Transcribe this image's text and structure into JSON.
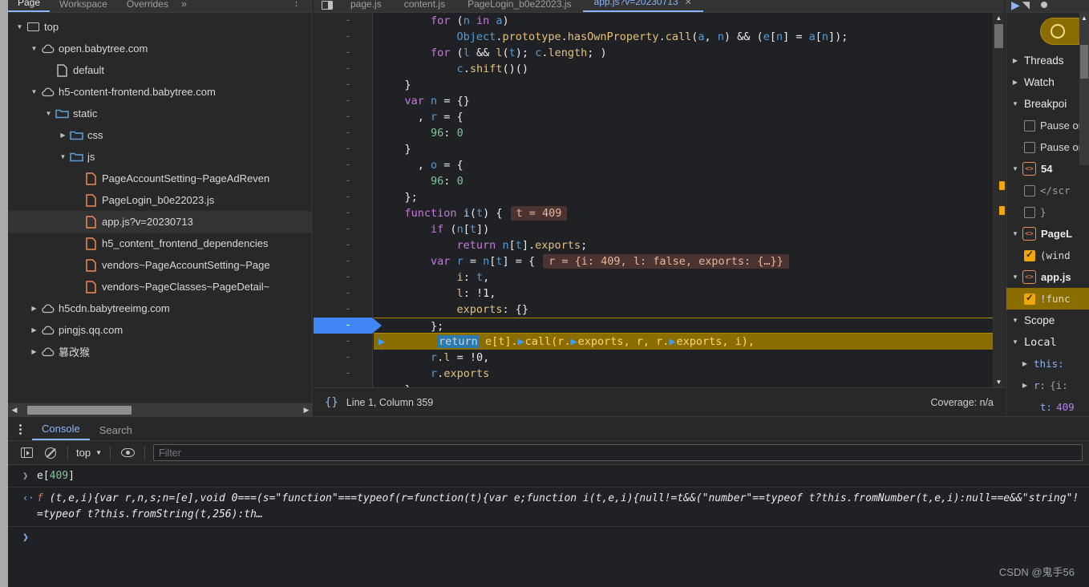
{
  "navigator": {
    "tabs": [
      {
        "label": "Page",
        "active": true
      },
      {
        "label": "Workspace",
        "active": false
      },
      {
        "label": "Overrides",
        "active": false
      }
    ],
    "more_label": "»",
    "kebab_label": "⋮",
    "tree": [
      {
        "indent": 0,
        "twisty": "▼",
        "icon": "frame-icon",
        "label": "top",
        "selected": false
      },
      {
        "indent": 1,
        "twisty": "▼",
        "icon": "cloud-icon",
        "label": "open.babytree.com",
        "selected": false
      },
      {
        "indent": 2,
        "twisty": "",
        "icon": "file-icon-plain",
        "label": "default",
        "selected": false
      },
      {
        "indent": 1,
        "twisty": "▼",
        "icon": "cloud-icon",
        "label": "h5-content-frontend.babytree.com",
        "selected": false
      },
      {
        "indent": 2,
        "twisty": "▼",
        "icon": "folder-icon",
        "label": "static",
        "selected": false
      },
      {
        "indent": 3,
        "twisty": "▶",
        "icon": "folder-icon",
        "label": "css",
        "selected": false
      },
      {
        "indent": 3,
        "twisty": "▼",
        "icon": "folder-icon",
        "label": "js",
        "selected": false
      },
      {
        "indent": 4,
        "twisty": "",
        "icon": "js-file-icon",
        "label": "PageAccountSetting~PageAdReven",
        "selected": false
      },
      {
        "indent": 4,
        "twisty": "",
        "icon": "js-file-icon",
        "label": "PageLogin_b0e22023.js",
        "selected": false
      },
      {
        "indent": 4,
        "twisty": "",
        "icon": "js-file-icon",
        "label": "app.js?v=20230713",
        "selected": true
      },
      {
        "indent": 4,
        "twisty": "",
        "icon": "js-file-icon",
        "label": "h5_content_frontend_dependencies",
        "selected": false
      },
      {
        "indent": 4,
        "twisty": "",
        "icon": "js-file-icon",
        "label": "vendors~PageAccountSetting~Page",
        "selected": false
      },
      {
        "indent": 4,
        "twisty": "",
        "icon": "js-file-icon",
        "label": "vendors~PageClasses~PageDetail~",
        "selected": false
      },
      {
        "indent": 1,
        "twisty": "▶",
        "icon": "cloud-icon",
        "label": "h5cdn.babytreeimg.com",
        "selected": false
      },
      {
        "indent": 1,
        "twisty": "▶",
        "icon": "cloud-icon",
        "label": "pingjs.qq.com",
        "selected": false
      },
      {
        "indent": 1,
        "twisty": "▶",
        "icon": "cloud-icon",
        "label": "篡改猴",
        "selected": false
      }
    ]
  },
  "editor": {
    "tabs": [
      {
        "label": "page.js",
        "active": false
      },
      {
        "label": "content.js",
        "active": false
      },
      {
        "label": "PageLogin_b0e22023.js",
        "active": false
      },
      {
        "label": "app.js?v=20230713",
        "active": true,
        "close": "✕"
      }
    ],
    "gutter_marks": [
      "-",
      "-",
      "-",
      "-",
      "-",
      "-",
      "-",
      "-",
      "-",
      "-",
      "-",
      "-",
      "-",
      "-",
      "-",
      "-",
      "-",
      "-",
      "-",
      "-",
      "-",
      "-",
      "-"
    ],
    "paused_line_index": 19,
    "lines": [
      {
        "segments": [
          {
            "t": "        ",
            "c": "plain"
          },
          {
            "t": "for",
            "c": "kw"
          },
          {
            "t": " (",
            "c": "punc"
          },
          {
            "t": "n",
            "c": "var"
          },
          {
            "t": " ",
            "c": "punc"
          },
          {
            "t": "in",
            "c": "kw"
          },
          {
            "t": " ",
            "c": "punc"
          },
          {
            "t": "a",
            "c": "var"
          },
          {
            "t": ")",
            "c": "punc"
          }
        ]
      },
      {
        "segments": [
          {
            "t": "            ",
            "c": "plain"
          },
          {
            "t": "Object",
            "c": "var"
          },
          {
            "t": ".",
            "c": "punc"
          },
          {
            "t": "prototype",
            "c": "prop"
          },
          {
            "t": ".",
            "c": "punc"
          },
          {
            "t": "hasOwnProperty",
            "c": "prop"
          },
          {
            "t": ".",
            "c": "punc"
          },
          {
            "t": "call",
            "c": "prop"
          },
          {
            "t": "(",
            "c": "punc"
          },
          {
            "t": "a",
            "c": "var"
          },
          {
            "t": ", ",
            "c": "punc"
          },
          {
            "t": "n",
            "c": "var"
          },
          {
            "t": ") && (",
            "c": "punc"
          },
          {
            "t": "e",
            "c": "var"
          },
          {
            "t": "[",
            "c": "punc"
          },
          {
            "t": "n",
            "c": "var"
          },
          {
            "t": "] = ",
            "c": "punc"
          },
          {
            "t": "a",
            "c": "var"
          },
          {
            "t": "[",
            "c": "punc"
          },
          {
            "t": "n",
            "c": "var"
          },
          {
            "t": "]);",
            "c": "punc"
          }
        ]
      },
      {
        "segments": [
          {
            "t": "        ",
            "c": "plain"
          },
          {
            "t": "for",
            "c": "kw"
          },
          {
            "t": " (",
            "c": "punc"
          },
          {
            "t": "l",
            "c": "var"
          },
          {
            "t": " ",
            "c": "punc"
          },
          {
            "t": "&&",
            "c": "white"
          },
          {
            "t": " ",
            "c": "punc"
          },
          {
            "t": "l",
            "c": "prop"
          },
          {
            "t": "(",
            "c": "punc"
          },
          {
            "t": "t",
            "c": "var"
          },
          {
            "t": "); ",
            "c": "punc"
          },
          {
            "t": "c",
            "c": "var"
          },
          {
            "t": ".",
            "c": "punc"
          },
          {
            "t": "length",
            "c": "prop"
          },
          {
            "t": "; )",
            "c": "punc"
          }
        ]
      },
      {
        "segments": [
          {
            "t": "            ",
            "c": "plain"
          },
          {
            "t": "c",
            "c": "var"
          },
          {
            "t": ".",
            "c": "punc"
          },
          {
            "t": "shift",
            "c": "prop"
          },
          {
            "t": "()()",
            "c": "punc"
          }
        ]
      },
      {
        "segments": [
          {
            "t": "    }",
            "c": "punc"
          }
        ]
      },
      {
        "segments": [
          {
            "t": "    ",
            "c": "plain"
          },
          {
            "t": "var",
            "c": "kw"
          },
          {
            "t": " ",
            "c": "punc"
          },
          {
            "t": "n",
            "c": "var"
          },
          {
            "t": " = {}",
            "c": "punc"
          }
        ]
      },
      {
        "segments": [
          {
            "t": "      , ",
            "c": "punc"
          },
          {
            "t": "r",
            "c": "var"
          },
          {
            "t": " = {",
            "c": "punc"
          }
        ]
      },
      {
        "segments": [
          {
            "t": "        ",
            "c": "plain"
          },
          {
            "t": "96",
            "c": "num"
          },
          {
            "t": ": ",
            "c": "punc"
          },
          {
            "t": "0",
            "c": "num"
          }
        ]
      },
      {
        "segments": [
          {
            "t": "    }",
            "c": "punc"
          }
        ]
      },
      {
        "segments": [
          {
            "t": "      , ",
            "c": "punc"
          },
          {
            "t": "o",
            "c": "var"
          },
          {
            "t": " = {",
            "c": "punc"
          }
        ]
      },
      {
        "segments": [
          {
            "t": "        ",
            "c": "plain"
          },
          {
            "t": "96",
            "c": "num"
          },
          {
            "t": ": ",
            "c": "punc"
          },
          {
            "t": "0",
            "c": "num"
          }
        ]
      },
      {
        "segments": [
          {
            "t": "    };",
            "c": "punc"
          }
        ]
      },
      {
        "segments": [
          {
            "t": "    ",
            "c": "plain"
          },
          {
            "t": "function",
            "c": "kw"
          },
          {
            "t": " ",
            "c": "punc"
          },
          {
            "t": "i",
            "c": "id"
          },
          {
            "t": "(",
            "c": "punc"
          },
          {
            "t": "t",
            "c": "var"
          },
          {
            "t": ") {",
            "c": "punc"
          }
        ],
        "inline_value": "t = 409"
      },
      {
        "segments": [
          {
            "t": "        ",
            "c": "plain"
          },
          {
            "t": "if",
            "c": "kw"
          },
          {
            "t": " (",
            "c": "punc"
          },
          {
            "t": "n",
            "c": "var"
          },
          {
            "t": "[",
            "c": "punc"
          },
          {
            "t": "t",
            "c": "var"
          },
          {
            "t": "])",
            "c": "punc"
          }
        ]
      },
      {
        "segments": [
          {
            "t": "            ",
            "c": "plain"
          },
          {
            "t": "return",
            "c": "kw"
          },
          {
            "t": " ",
            "c": "punc"
          },
          {
            "t": "n",
            "c": "var"
          },
          {
            "t": "[",
            "c": "punc"
          },
          {
            "t": "t",
            "c": "var"
          },
          {
            "t": "].",
            "c": "punc"
          },
          {
            "t": "exports",
            "c": "prop"
          },
          {
            "t": ";",
            "c": "punc"
          }
        ]
      },
      {
        "segments": [
          {
            "t": "        ",
            "c": "plain"
          },
          {
            "t": "var",
            "c": "kw"
          },
          {
            "t": " ",
            "c": "punc"
          },
          {
            "t": "r",
            "c": "var"
          },
          {
            "t": " = ",
            "c": "punc"
          },
          {
            "t": "n",
            "c": "var"
          },
          {
            "t": "[",
            "c": "punc"
          },
          {
            "t": "t",
            "c": "var"
          },
          {
            "t": "] = {",
            "c": "punc"
          }
        ],
        "inline_value": "r = {i: 409, l: false, exports: {…}}"
      },
      {
        "segments": [
          {
            "t": "            ",
            "c": "plain"
          },
          {
            "t": "i",
            "c": "prop"
          },
          {
            "t": ": ",
            "c": "punc"
          },
          {
            "t": "t",
            "c": "var"
          },
          {
            "t": ",",
            "c": "punc"
          }
        ]
      },
      {
        "segments": [
          {
            "t": "            ",
            "c": "plain"
          },
          {
            "t": "l",
            "c": "prop"
          },
          {
            "t": ": ",
            "c": "punc"
          },
          {
            "t": "!1",
            "c": "white"
          },
          {
            "t": ",",
            "c": "punc"
          }
        ]
      },
      {
        "segments": [
          {
            "t": "            ",
            "c": "plain"
          },
          {
            "t": "exports",
            "c": "prop"
          },
          {
            "t": ": {}",
            "c": "punc"
          }
        ]
      },
      {
        "segments": [
          {
            "t": "        };",
            "c": "punc"
          }
        ]
      },
      {
        "segments": [
          {
            "t": "        ",
            "c": "plain"
          },
          {
            "t": "return",
            "c": "sel"
          },
          {
            "t": " ",
            "c": "punc"
          },
          {
            "t": "e",
            "c": "pz"
          },
          {
            "t": "[",
            "c": "pz"
          },
          {
            "t": "t",
            "c": "pz"
          },
          {
            "t": "].",
            "c": "pz"
          },
          {
            "t": "call",
            "c": "pzp"
          },
          {
            "t": "(",
            "c": "pz"
          },
          {
            "t": "r",
            "c": "pz"
          },
          {
            "t": ".",
            "c": "pz"
          },
          {
            "t": "exports",
            "c": "pzp"
          },
          {
            "t": ", ",
            "c": "pz"
          },
          {
            "t": "r",
            "c": "pz"
          },
          {
            "t": ", ",
            "c": "pz"
          },
          {
            "t": "r",
            "c": "pz"
          },
          {
            "t": ".",
            "c": "pz"
          },
          {
            "t": "exports",
            "c": "pzp"
          },
          {
            "t": ", ",
            "c": "pz"
          },
          {
            "t": "i",
            "c": "pz"
          },
          {
            "t": "),",
            "c": "pz"
          }
        ],
        "paused": true
      },
      {
        "segments": [
          {
            "t": "        ",
            "c": "plain"
          },
          {
            "t": "r",
            "c": "var"
          },
          {
            "t": ".",
            "c": "punc"
          },
          {
            "t": "l",
            "c": "prop"
          },
          {
            "t": " = ",
            "c": "punc"
          },
          {
            "t": "!0",
            "c": "white"
          },
          {
            "t": ",",
            "c": "punc"
          }
        ]
      },
      {
        "segments": [
          {
            "t": "        ",
            "c": "plain"
          },
          {
            "t": "r",
            "c": "var"
          },
          {
            "t": ".",
            "c": "punc"
          },
          {
            "t": "exports",
            "c": "prop"
          }
        ]
      },
      {
        "segments": [
          {
            "t": "    }",
            "c": "punc"
          }
        ]
      }
    ],
    "status": {
      "pretty_print_icon": "{}",
      "position": "Line 1, Column 359",
      "coverage": "Coverage: n/a"
    }
  },
  "debugger": {
    "toolbar": {
      "resume_icon": "resume-icon",
      "step_over_icon": "step-over-icon",
      "more_icon": "more-icon"
    },
    "sections": [
      {
        "type": "section",
        "twisty": "▶",
        "label": "Threads"
      },
      {
        "type": "section",
        "twisty": "▶",
        "label": "Watch"
      },
      {
        "type": "section",
        "twisty": "▼",
        "label": "Breakpoi"
      },
      {
        "type": "checkbox",
        "checked": false,
        "label": "Pause on"
      },
      {
        "type": "checkbox",
        "checked": false,
        "label": "Pause on"
      },
      {
        "type": "group",
        "twisty": "▼",
        "badge": "<>",
        "label": "54"
      },
      {
        "type": "bp",
        "checked": false,
        "label": "</scr"
      },
      {
        "type": "bp",
        "checked": false,
        "label": "}"
      },
      {
        "type": "group",
        "twisty": "▼",
        "badge": "<>",
        "label": "PageL"
      },
      {
        "type": "bp",
        "checked": true,
        "label": "(wind"
      },
      {
        "type": "group",
        "twisty": "▼",
        "badge": "<>",
        "label": "app.js"
      },
      {
        "type": "bp",
        "checked": true,
        "label": "!func",
        "highlighted": true
      },
      {
        "type": "section",
        "twisty": "▼",
        "label": "Scope"
      },
      {
        "type": "scope",
        "twisty": "▼",
        "label": "Local"
      },
      {
        "type": "scopevar",
        "twisty": "▶",
        "name": "this:",
        "value": ""
      },
      {
        "type": "scopevar",
        "twisty": "▶",
        "name": "r:",
        "value": "{i:"
      },
      {
        "type": "scopeval",
        "name": "t:",
        "value": "409"
      }
    ]
  },
  "drawer": {
    "kebab": "⋮",
    "tabs": [
      {
        "label": "Console",
        "active": true
      },
      {
        "label": "Search",
        "active": false
      }
    ],
    "toolbar": {
      "sidebar_icon": "console-sidebar-icon",
      "clear_icon": "clear-console-icon",
      "context": "top",
      "context_caret": "▼",
      "eye_icon": "live-expression-icon",
      "filter_placeholder": "Filter"
    },
    "messages": [
      {
        "type": "input",
        "arrow": "❯",
        "expr_prefix": "e[",
        "expr_num": "409",
        "expr_suffix": "]"
      },
      {
        "type": "output",
        "arrow": "‹·",
        "fn_keyword": "f",
        "text": " (t,e,i){var r,n,s;n=[e],void 0===(s=\"function\"===typeof(r=function(t){var e;function i(t,e,i){null!=t&&(\"number\"==typeof t?this.fromNumber(t,e,i):null==e&&\"string\"!=typeof t?this.fromString(t,256):th…"
      }
    ],
    "prompt_caret": "❯"
  },
  "watermark": "CSDN @鬼手56",
  "colors": {
    "accent_blue": "#8ab4f8",
    "paused_yellow": "#8a6d00",
    "breakpoint_orange": "#f2a60c",
    "panel_bg": "#282828",
    "editor_bg": "#202124"
  }
}
